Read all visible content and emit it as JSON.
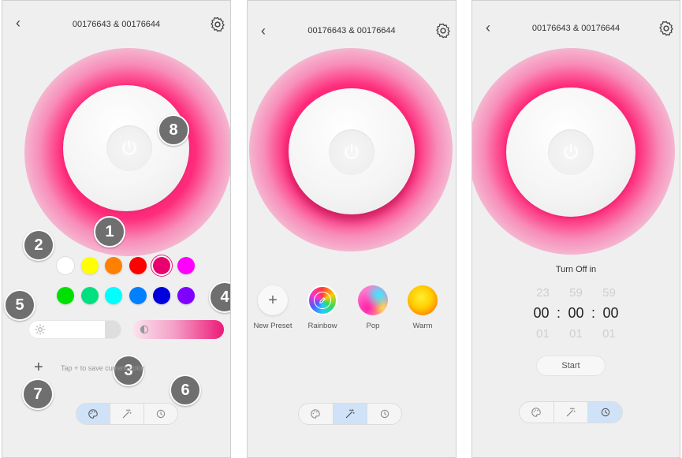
{
  "screens": [
    {
      "title": "00176643 & 00176644",
      "badges": [
        "1",
        "2",
        "3",
        "4",
        "5",
        "6",
        "7",
        "8"
      ],
      "colors_row1": [
        "#ffffff",
        "#ffff00",
        "#ff8000",
        "#ff0000",
        "#e8006e",
        "#ff00ff"
      ],
      "colors_row2": [
        "#00e000",
        "#00e080",
        "#00ffff",
        "#0080ff",
        "#0000dd",
        "#8000ff"
      ],
      "save_hint": "Tap + to save current color"
    },
    {
      "title": "00176643 & 00176644",
      "presets": [
        {
          "label": "New Preset"
        },
        {
          "label": "Rainbow"
        },
        {
          "label": "Pop"
        },
        {
          "label": "Warm"
        }
      ]
    },
    {
      "title": "00176643 & 00176644",
      "timer_label": "Turn Off in",
      "prev": [
        "23",
        "59",
        "59"
      ],
      "current": [
        "00",
        ":",
        "00",
        ":",
        "00"
      ],
      "next": [
        "01",
        "01",
        "01"
      ],
      "start_label": "Start"
    }
  ],
  "icons": {
    "back": "chevron-left-icon",
    "settings": "gear-icon",
    "power": "power-icon",
    "palette": "palette-icon",
    "magic": "magic-wand-icon",
    "timer": "timer-icon",
    "sun": "sun-icon",
    "contrast": "contrast-icon",
    "edit": "pencil-icon",
    "plus": "plus-icon"
  },
  "accent_color": "#ff1f74",
  "active_tab_color": "#cfe2f7"
}
